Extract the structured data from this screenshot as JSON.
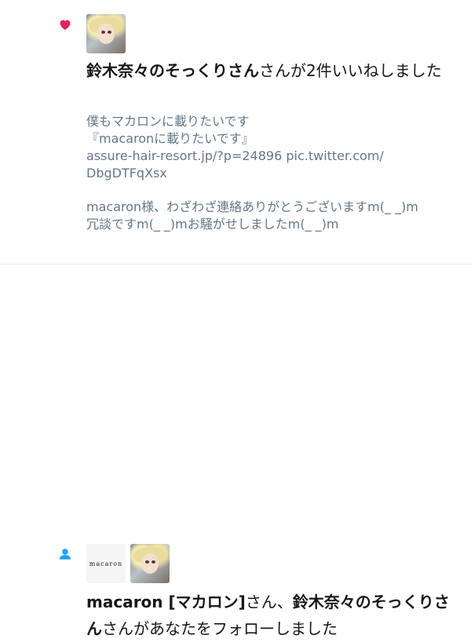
{
  "like_notification": {
    "icon": "heart-icon",
    "icon_color": "#e0245e",
    "user_name": "鈴木奈々のそっくりさん",
    "action_text": "さんが2件いいねしました",
    "tweet_lines": [
      "僕もマカロンに載りたいです",
      "『macaronに載りたいです』",
      "assure-hair-resort.jp/?p=24896 pic.twitter.com/",
      "DbgDTFqXsx"
    ],
    "reply_lines": [
      "macaron様、わざわざ連絡ありがとうございますm(_ _)m",
      "冗談ですm(_ _)mお騒がせしましたm(_ _)m"
    ]
  },
  "follow_notification": {
    "icon": "person-icon",
    "icon_color": "#1da1f2",
    "logo_text": "macaron",
    "user_name_1": "macaron [マカロン]",
    "separator": "さん、",
    "user_name_2": "鈴木奈々のそっくりさん",
    "action_text": "さんがあなたをフォローしました"
  }
}
